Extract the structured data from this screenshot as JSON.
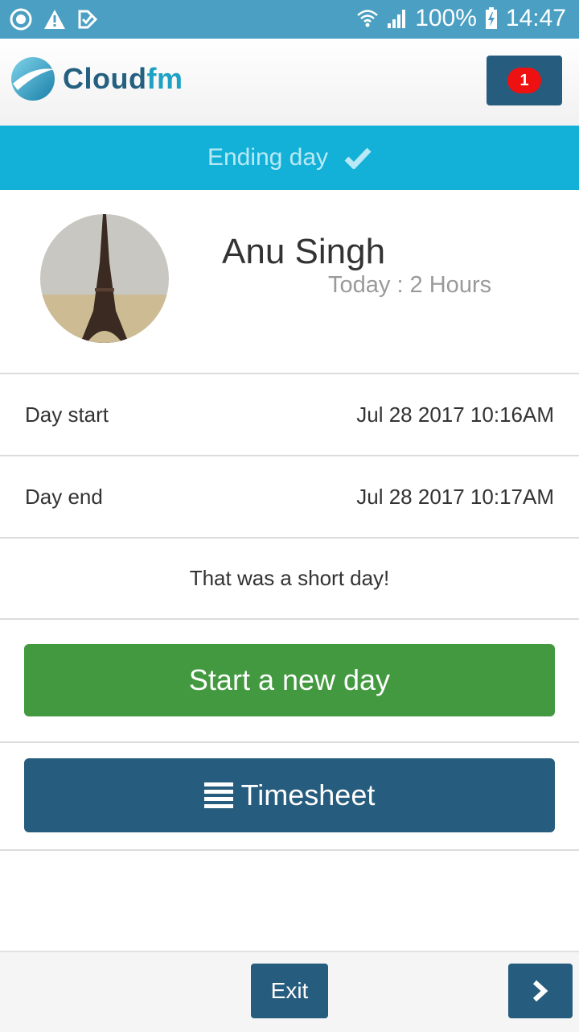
{
  "status_bar": {
    "battery": "100%",
    "time": "14:47"
  },
  "header": {
    "logo_part1": "Cloud",
    "logo_part2": "fm",
    "notification_count": "1"
  },
  "banner": {
    "text": "Ending day"
  },
  "profile": {
    "name": "Anu Singh",
    "today": "Today : 2 Hours"
  },
  "details": [
    {
      "label": "Day start",
      "value": "Jul 28 2017 10:16AM"
    },
    {
      "label": "Day end",
      "value": "Jul 28 2017 10:17AM"
    }
  ],
  "message": "That was a short day!",
  "actions": {
    "start_new_day": "Start a new day",
    "timesheet": "Timesheet"
  },
  "footer": {
    "exit": "Exit"
  },
  "colors": {
    "status_bar": "#4a9fc3",
    "banner": "#13b1d7",
    "primary": "#265c7d",
    "success": "#43993f",
    "badge": "#ee1111"
  }
}
